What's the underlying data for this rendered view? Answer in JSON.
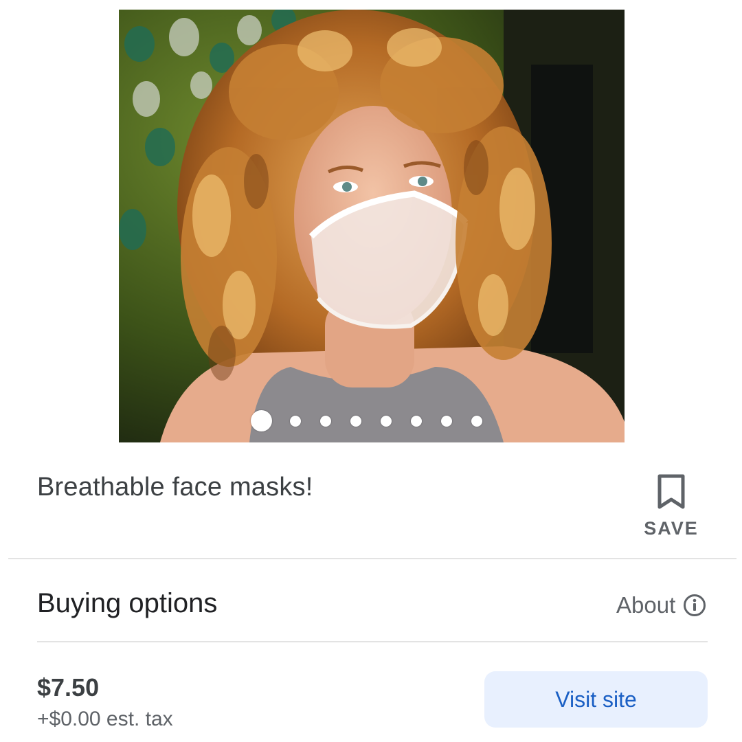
{
  "product": {
    "image_alt": "Woman with curly hair wearing a sheer breathable face mask",
    "carousel": {
      "total_images": 8,
      "active_index": 0
    },
    "title": "Breathable face masks!"
  },
  "save": {
    "label": "SAVE",
    "icon": "bookmark-icon"
  },
  "buying_options": {
    "heading": "Buying options",
    "about_label": "About",
    "about_icon": "info-icon",
    "offers": [
      {
        "price": "$7.50",
        "tax": "+$0.00 est. tax",
        "button_label": "Visit site"
      }
    ]
  },
  "colors": {
    "accent": "#1a5fc4",
    "button_bg": "#e8f0fe",
    "divider": "#e3e3e3",
    "secondary_text": "#5f6368"
  }
}
